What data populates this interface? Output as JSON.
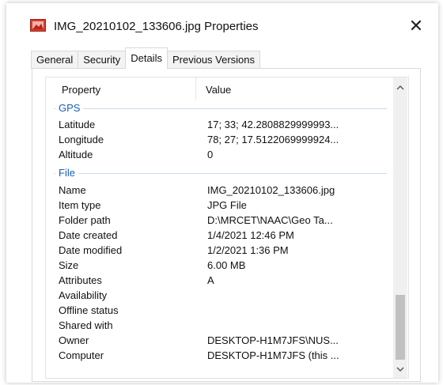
{
  "window": {
    "title": "IMG_20210102_133606.jpg Properties",
    "close_label": "✕"
  },
  "tabs": [
    {
      "label": "General",
      "active": false
    },
    {
      "label": "Security",
      "active": false
    },
    {
      "label": "Details",
      "active": true
    },
    {
      "label": "Previous Versions",
      "active": false
    }
  ],
  "list": {
    "header_property": "Property",
    "header_value": "Value",
    "groups": {
      "gps": "GPS",
      "file": "File"
    },
    "gps_rows": [
      {
        "key": "Latitude",
        "value": "17; 33; 42.2808829999993..."
      },
      {
        "key": "Longitude",
        "value": "78; 27; 17.5122069999924..."
      },
      {
        "key": "Altitude",
        "value": "0"
      }
    ],
    "file_rows": [
      {
        "key": "Name",
        "value": "IMG_20210102_133606.jpg"
      },
      {
        "key": "Item type",
        "value": "JPG File"
      },
      {
        "key": "Folder path",
        "value": "D:\\MRCET\\NAAC\\Geo Ta..."
      },
      {
        "key": "Date created",
        "value": "1/4/2021 12:46 PM"
      },
      {
        "key": "Date modified",
        "value": "1/2/2021 1:36 PM"
      },
      {
        "key": "Size",
        "value": "6.00 MB"
      },
      {
        "key": "Attributes",
        "value": "A"
      },
      {
        "key": "Availability",
        "value": ""
      },
      {
        "key": "Offline status",
        "value": ""
      },
      {
        "key": "Shared with",
        "value": ""
      },
      {
        "key": "Owner",
        "value": "DESKTOP-H1M7JFS\\NUS..."
      },
      {
        "key": "Computer",
        "value": "DESKTOP-H1M7JFS (this ..."
      }
    ]
  },
  "icons": {
    "app": "image-file-icon",
    "scroll_up": "chevron-up-icon",
    "scroll_down": "chevron-down-icon"
  },
  "colors": {
    "group_heading": "#1a5fb4",
    "app_icon": "#d83b2d"
  }
}
